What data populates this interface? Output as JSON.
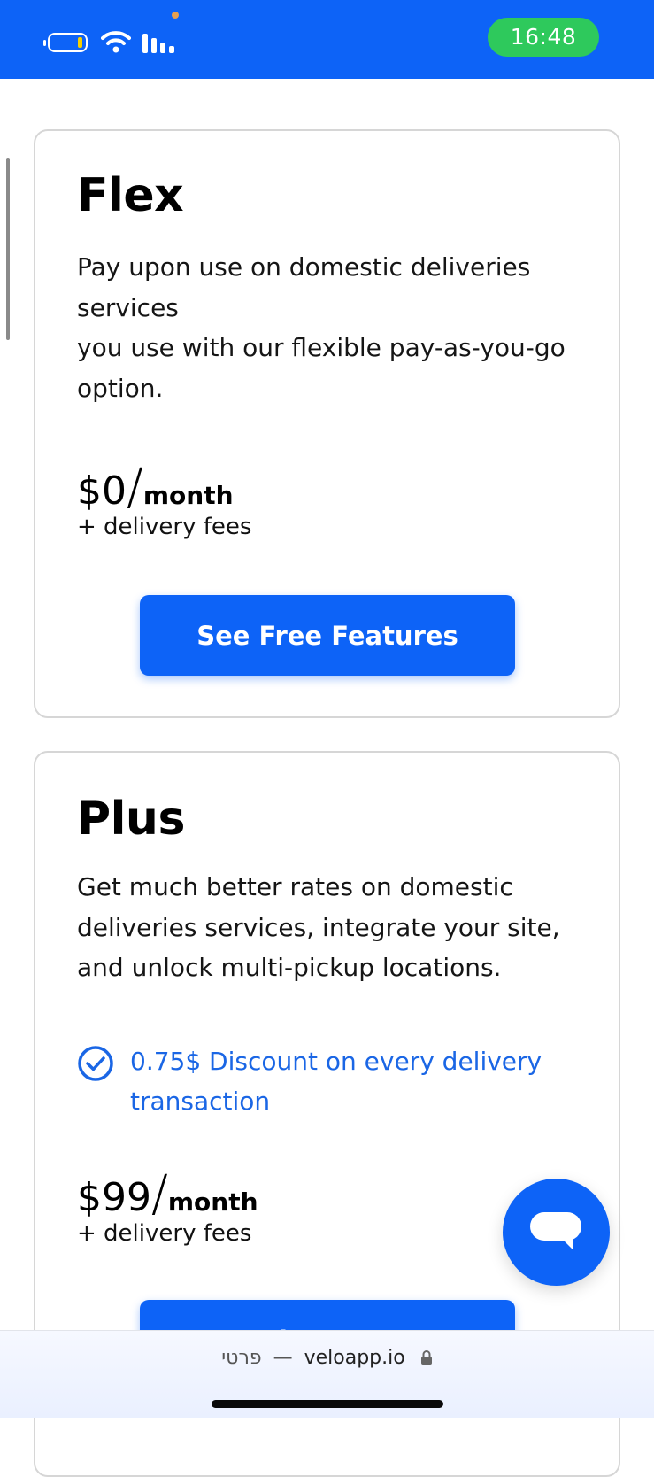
{
  "status_bar": {
    "time": "16:48",
    "battery_icon": "battery-low-icon",
    "wifi_icon": "wifi-icon",
    "signal_icon": "cellular-signal-icon",
    "background_color": "#0d63f7",
    "time_pill_color": "#2ec95c"
  },
  "plans": [
    {
      "title": "Flex",
      "description": "Pay upon use on domestic deliveries services\nyou use with our flexible pay-as-you-go option.",
      "price_amount": "$0",
      "price_slash": "/",
      "price_unit": "month",
      "price_note": "+ delivery fees",
      "button_label": "See Free Features"
    },
    {
      "title": "Plus",
      "description": "Get much better rates on domestic deliveries services, integrate your site, and unlock multi-pickup locations.",
      "feature": "0.75$ Discount on every delivery transaction",
      "feature_icon": "check-circle-icon",
      "price_amount": "$99",
      "price_slash": "/",
      "price_unit": "month",
      "price_note": "+ delivery fees",
      "button_label": "See Plus Features"
    }
  ],
  "chat": {
    "icon": "chat-bubble-icon"
  },
  "browser": {
    "label": "פרטי",
    "separator": "—",
    "domain": "veloapp.io",
    "lock_icon": "lock-icon"
  },
  "colors": {
    "accent": "#0d63f7",
    "feature_text": "#1a66e5"
  }
}
